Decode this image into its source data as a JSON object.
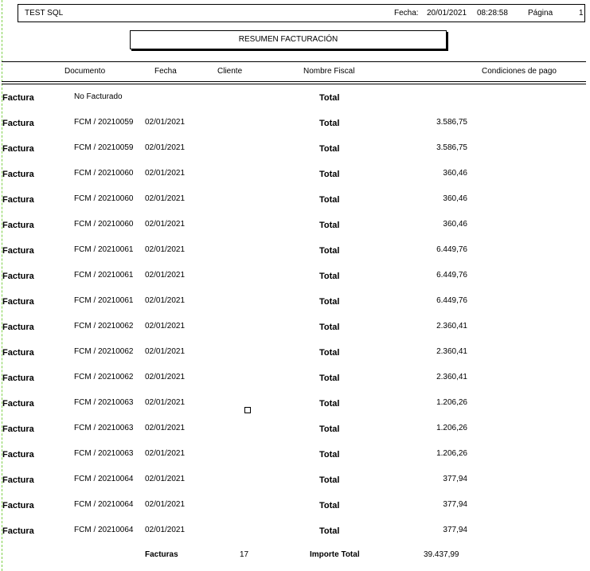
{
  "header": {
    "app_title": "TEST SQL",
    "fecha_label": "Fecha:",
    "fecha_value": "20/01/2021",
    "time_value": "08:28:58",
    "pagina_label": "Página",
    "pagina_value": "1"
  },
  "report_title": "RESUMEN FACTURACIÓN",
  "columns": {
    "documento": "Documento",
    "fecha": "Fecha",
    "cliente": "Cliente",
    "nombre_fiscal": "Nombre Fiscal",
    "condiciones": "Condiciones de pago"
  },
  "rows": [
    {
      "type": "Factura",
      "documento": "No Facturado",
      "fecha": "",
      "total_label": "Total",
      "importe": ""
    },
    {
      "type": "Factura",
      "documento": "FCM / 20210059",
      "fecha": "02/01/2021",
      "total_label": "Total",
      "importe": "3.586,75"
    },
    {
      "type": "Factura",
      "documento": "FCM / 20210059",
      "fecha": "02/01/2021",
      "total_label": "Total",
      "importe": "3.586,75"
    },
    {
      "type": "Factura",
      "documento": "FCM / 20210060",
      "fecha": "02/01/2021",
      "total_label": "Total",
      "importe": "360,46"
    },
    {
      "type": "Factura",
      "documento": "FCM / 20210060",
      "fecha": "02/01/2021",
      "total_label": "Total",
      "importe": "360,46"
    },
    {
      "type": "Factura",
      "documento": "FCM / 20210060",
      "fecha": "02/01/2021",
      "total_label": "Total",
      "importe": "360,46"
    },
    {
      "type": "Factura",
      "documento": "FCM / 20210061",
      "fecha": "02/01/2021",
      "total_label": "Total",
      "importe": "6.449,76"
    },
    {
      "type": "Factura",
      "documento": "FCM / 20210061",
      "fecha": "02/01/2021",
      "total_label": "Total",
      "importe": "6.449,76"
    },
    {
      "type": "Factura",
      "documento": "FCM / 20210061",
      "fecha": "02/01/2021",
      "total_label": "Total",
      "importe": "6.449,76"
    },
    {
      "type": "Factura",
      "documento": "FCM / 20210062",
      "fecha": "02/01/2021",
      "total_label": "Total",
      "importe": "2.360,41"
    },
    {
      "type": "Factura",
      "documento": "FCM / 20210062",
      "fecha": "02/01/2021",
      "total_label": "Total",
      "importe": "2.360,41"
    },
    {
      "type": "Factura",
      "documento": "FCM / 20210062",
      "fecha": "02/01/2021",
      "total_label": "Total",
      "importe": "2.360,41"
    },
    {
      "type": "Factura",
      "documento": "FCM / 20210063",
      "fecha": "02/01/2021",
      "total_label": "Total",
      "importe": "1.206,26"
    },
    {
      "type": "Factura",
      "documento": "FCM / 20210063",
      "fecha": "02/01/2021",
      "total_label": "Total",
      "importe": "1.206,26"
    },
    {
      "type": "Factura",
      "documento": "FCM / 20210063",
      "fecha": "02/01/2021",
      "total_label": "Total",
      "importe": "1.206,26"
    },
    {
      "type": "Factura",
      "documento": "FCM / 20210064",
      "fecha": "02/01/2021",
      "total_label": "Total",
      "importe": "377,94"
    },
    {
      "type": "Factura",
      "documento": "FCM / 20210064",
      "fecha": "02/01/2021",
      "total_label": "Total",
      "importe": "377,94"
    },
    {
      "type": "Factura",
      "documento": "FCM / 20210064",
      "fecha": "02/01/2021",
      "total_label": "Total",
      "importe": "377,94"
    }
  ],
  "footer": {
    "facturas_label": "Facturas",
    "facturas_count": "17",
    "importe_total_label": "Importe Total",
    "importe_total_value": "39.437,99"
  }
}
